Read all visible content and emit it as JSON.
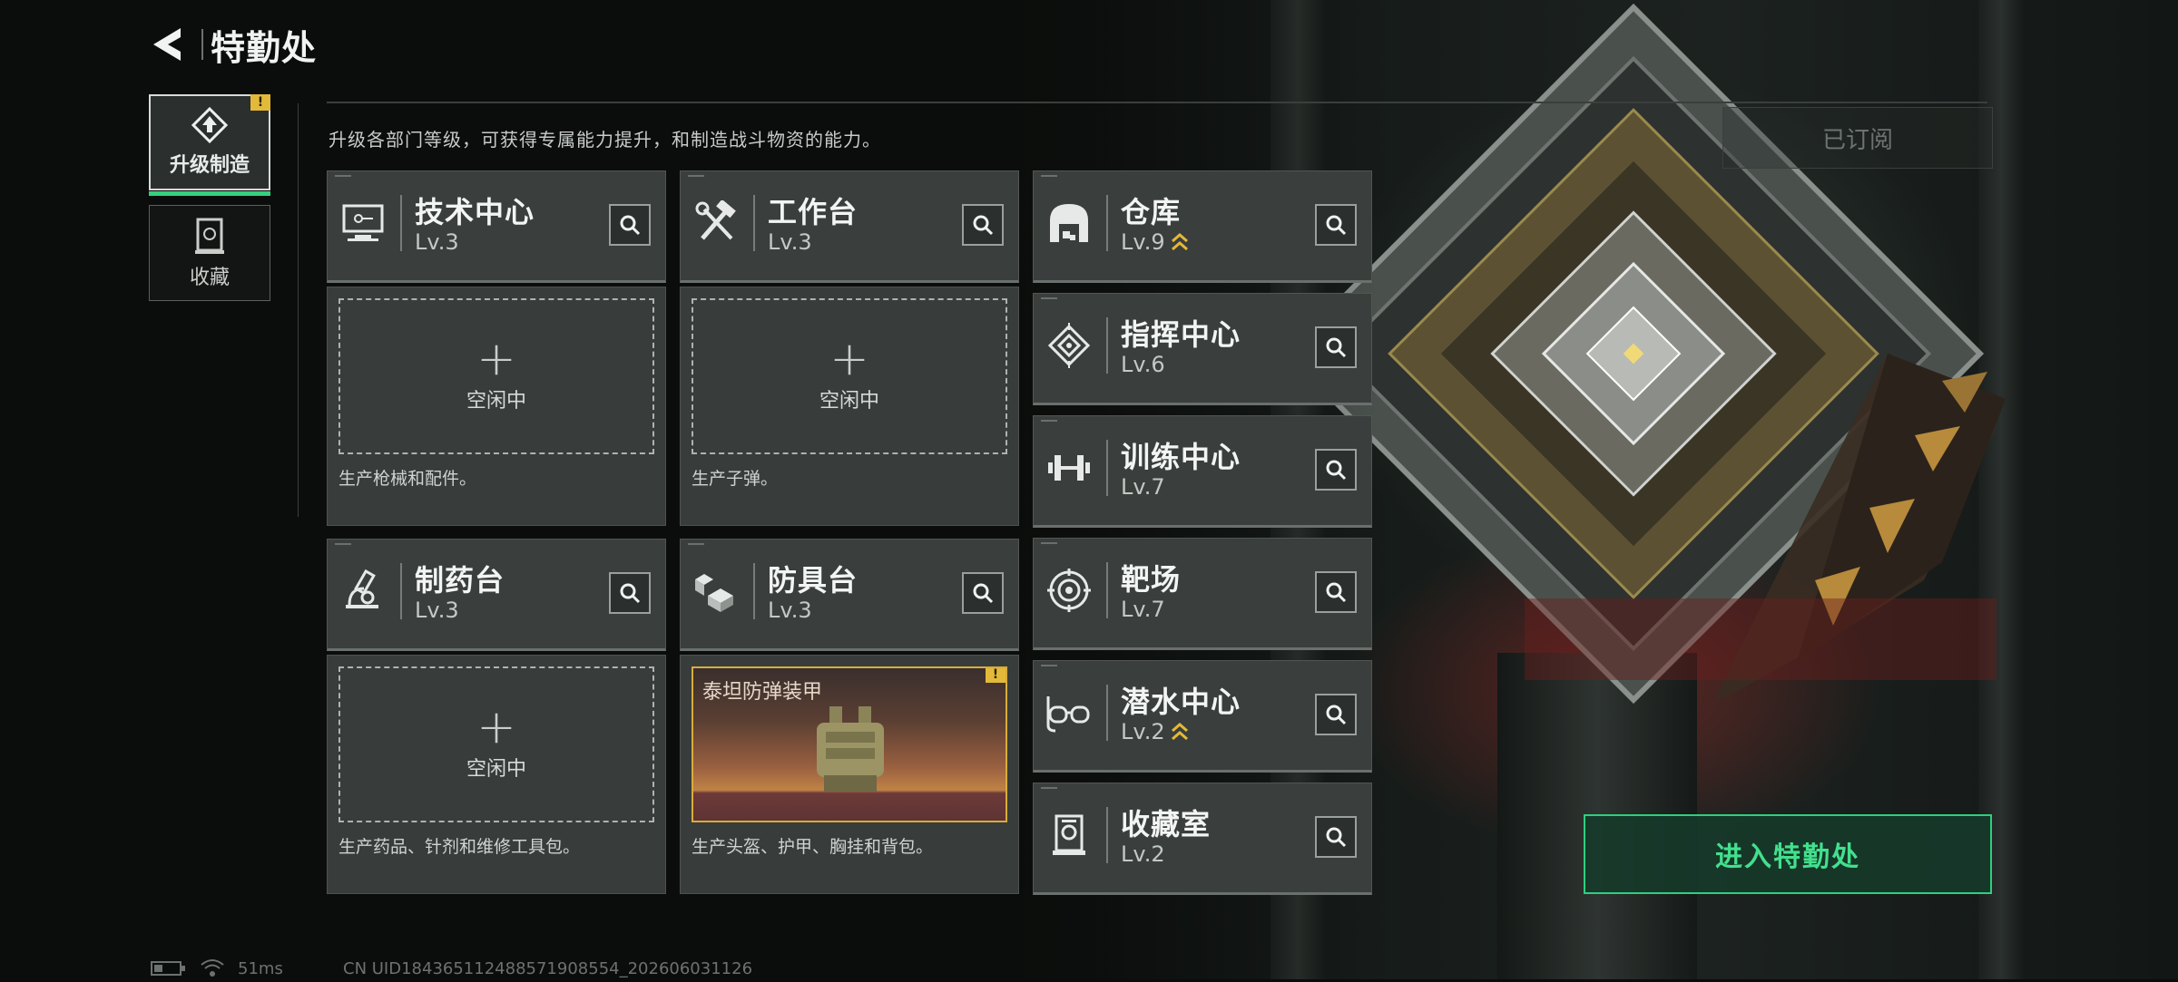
{
  "header": {
    "title": "特勤处"
  },
  "rail": {
    "tabs": [
      {
        "label": "升级制造",
        "active": true,
        "badge": "!"
      },
      {
        "label": "收藏",
        "active": false
      }
    ]
  },
  "subtitle": "升级各部门等级，可获得专属能力提升，和制造战斗物资的能力。",
  "subscribed_label": "已订阅",
  "idle_label": "空闲中",
  "modules": {
    "tech": {
      "name": "技术中心",
      "level": "Lv.3",
      "desc": "生产枪械和配件。"
    },
    "workbench": {
      "name": "工作台",
      "level": "Lv.3",
      "desc": "生产子弹。"
    },
    "pharmacy": {
      "name": "制药台",
      "level": "Lv.3",
      "desc": "生产药品、针剂和维修工具包。"
    },
    "armor": {
      "name": "防具台",
      "level": "Lv.3",
      "desc": "生产头盔、护甲、胸挂和背包。",
      "item_name": "泰坦防弹装甲",
      "item_badge": "!"
    },
    "warehouse": {
      "name": "仓库",
      "level": "Lv.9",
      "upgradable": true
    },
    "command": {
      "name": "指挥中心",
      "level": "Lv.6"
    },
    "training": {
      "name": "训练中心",
      "level": "Lv.7"
    },
    "range": {
      "name": "靶场",
      "level": "Lv.7"
    },
    "diving": {
      "name": "潜水中心",
      "level": "Lv.2",
      "upgradable": true
    },
    "collection": {
      "name": "收藏室",
      "level": "Lv.2"
    }
  },
  "enter_button": "进入特勤处",
  "status_bar": {
    "ping": "51ms",
    "uid": "CN UID18436511248857190855​4_202606031126"
  },
  "colors": {
    "accent_green": "#35d07f",
    "alert_yellow": "#e3b93a",
    "item_gold": "#d9ac3c"
  }
}
